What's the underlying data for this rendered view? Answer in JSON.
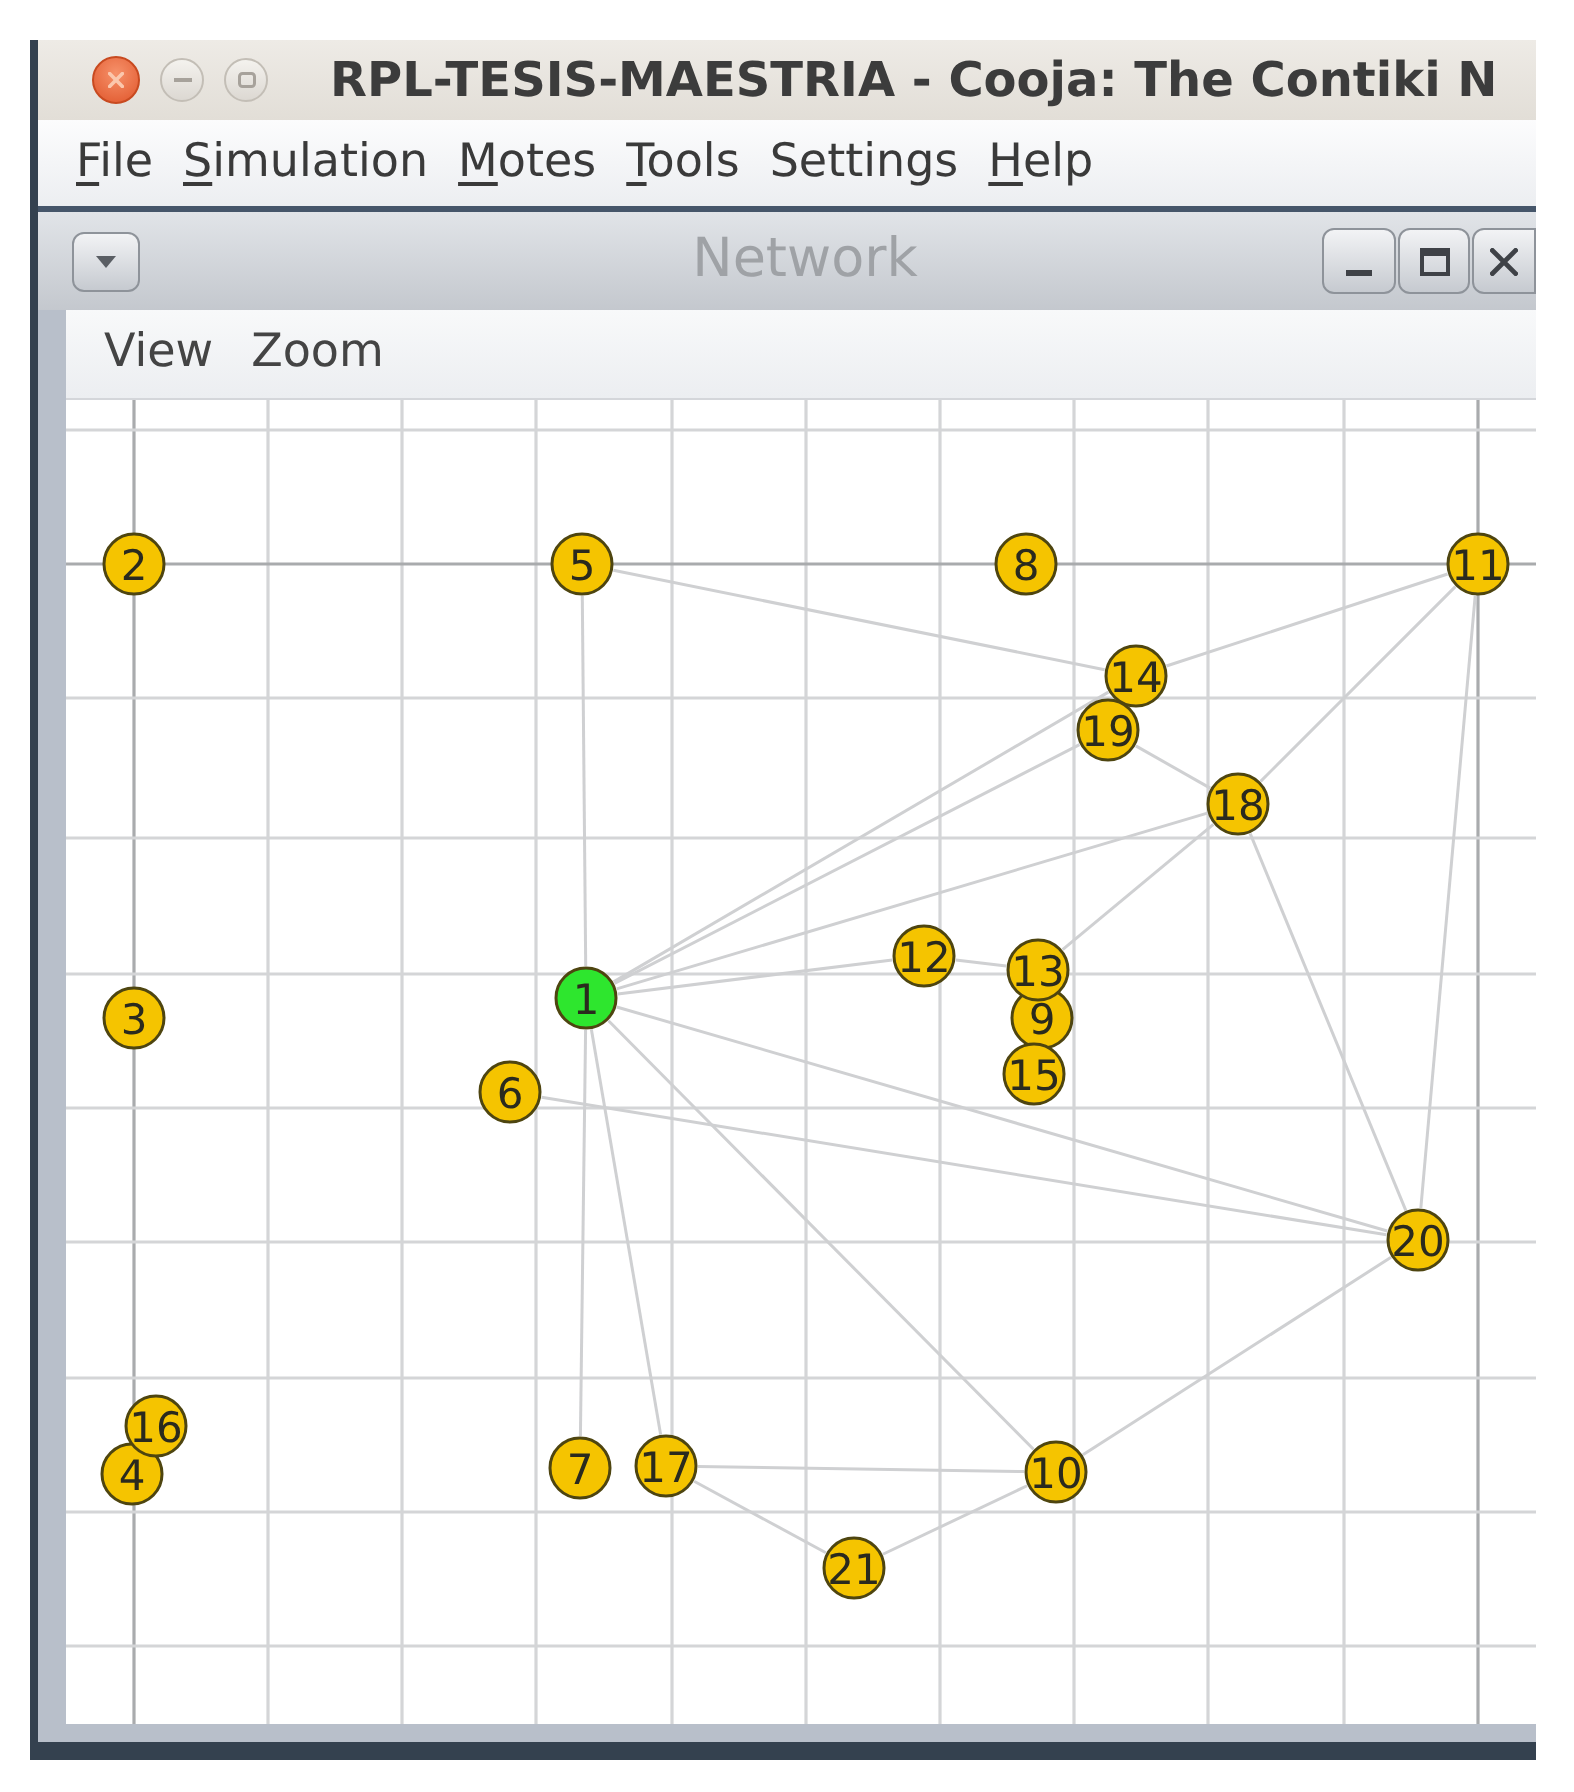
{
  "window": {
    "title": "RPL-TESIS-MAESTRIA - Cooja: The Contiki N"
  },
  "menu": [
    {
      "label": "File",
      "mnemonic_underlined": true
    },
    {
      "label": "Simulation",
      "mnemonic_underlined": true
    },
    {
      "label": "Motes",
      "mnemonic_underlined": true
    },
    {
      "label": "Tools",
      "mnemonic_underlined": true
    },
    {
      "label": "Settings",
      "mnemonic_underlined": false
    },
    {
      "label": "Help",
      "mnemonic_underlined": true
    }
  ],
  "network_window": {
    "title": "Network",
    "menu": [
      "View",
      "Zoom"
    ],
    "motes": [
      {
        "label": "1",
        "color": "#2ee62e"
      },
      {
        "label": "2",
        "color": "#f5c400"
      },
      {
        "label": "3",
        "color": "#f5c400"
      },
      {
        "label": "4",
        "color": "#f5c400"
      },
      {
        "label": "5",
        "color": "#f5c400"
      },
      {
        "label": "6",
        "color": "#f5c400"
      },
      {
        "label": "7",
        "color": "#f5c400"
      },
      {
        "label": "8",
        "color": "#f5c400"
      },
      {
        "label": "9",
        "color": "#f5c400"
      },
      {
        "label": "10",
        "color": "#f5c400"
      },
      {
        "label": "11",
        "color": "#f5c400"
      },
      {
        "label": "12",
        "color": "#f5c400"
      },
      {
        "label": "13",
        "color": "#f5c400"
      },
      {
        "label": "14",
        "color": "#f5c400"
      },
      {
        "label": "15",
        "color": "#f5c400"
      },
      {
        "label": "16",
        "color": "#f5c400"
      },
      {
        "label": "17",
        "color": "#f5c400"
      },
      {
        "label": "18",
        "color": "#f5c400"
      },
      {
        "label": "19",
        "color": "#f5c400"
      },
      {
        "label": "20",
        "color": "#f5c400"
      },
      {
        "label": "21",
        "color": "#f5c400"
      }
    ]
  }
}
